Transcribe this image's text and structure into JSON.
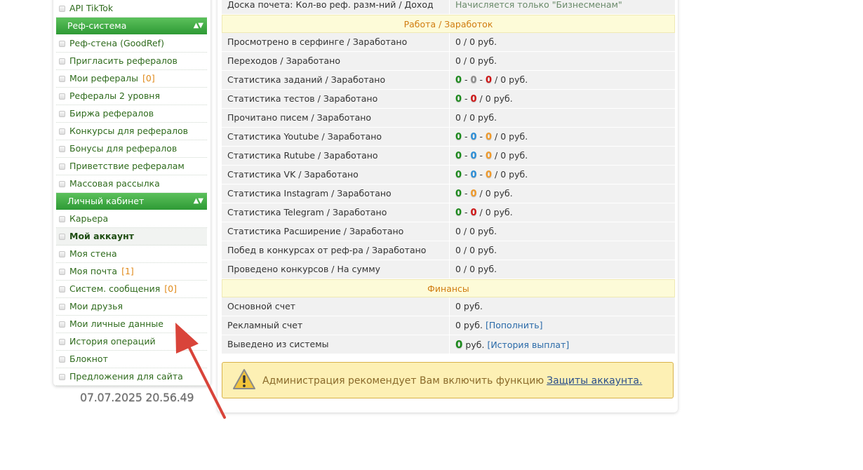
{
  "sidebar": {
    "items": [
      {
        "type": "item",
        "label": "API TikTok"
      },
      {
        "type": "header",
        "label": "Реф-система",
        "toggle": "▲▼"
      },
      {
        "type": "item",
        "label": "Реф-стена (GoodRef)"
      },
      {
        "type": "item",
        "label": "Пригласить рефералов"
      },
      {
        "type": "item",
        "label": "Мои рефералы",
        "count": "[0]"
      },
      {
        "type": "item",
        "label": "Рефералы 2 уровня"
      },
      {
        "type": "item",
        "label": "Биржа рефералов"
      },
      {
        "type": "item",
        "label": "Конкурсы для рефералов"
      },
      {
        "type": "item",
        "label": "Бонусы для рефералов"
      },
      {
        "type": "item",
        "label": "Приветствие рефералам"
      },
      {
        "type": "item",
        "label": "Массовая рассылка"
      },
      {
        "type": "header",
        "label": "Личный кабинет",
        "toggle": "▲▼"
      },
      {
        "type": "item",
        "label": "Карьера"
      },
      {
        "type": "item",
        "label": "Мой аккаунт",
        "active": true
      },
      {
        "type": "item",
        "label": "Моя стена"
      },
      {
        "type": "item",
        "label": "Моя почта",
        "count": "[1]"
      },
      {
        "type": "item",
        "label": "Систем. сообщения",
        "count": "[0]"
      },
      {
        "type": "item",
        "label": "Мои друзья"
      },
      {
        "type": "item",
        "label": "Мои личные данные"
      },
      {
        "type": "item",
        "label": "История операций"
      },
      {
        "type": "item",
        "label": "Блокнот"
      },
      {
        "type": "item",
        "label": "Предложения для сайта"
      }
    ]
  },
  "timestamp": "07.07.2025 20.56.49",
  "stats": {
    "honor_row": {
      "label": "Доска почета: Кол-во реф. разм-ний / Доход",
      "note": "Начисляется только \"Бизнесменам\""
    },
    "work_section": "Работа / Заработок",
    "rows": [
      {
        "label": "Просмотрено в серфинге / Заработано",
        "parts": [],
        "tail": "0 / 0 руб."
      },
      {
        "label": "Переходов / Заработано",
        "parts": [],
        "tail": "0 / 0 руб."
      },
      {
        "label": "Статистика заданий / Заработано",
        "parts": [
          {
            "v": "0",
            "c": "green"
          },
          {
            "v": "0",
            "c": "gray"
          },
          {
            "v": "0",
            "c": "red"
          }
        ],
        "tail": " / 0 руб."
      },
      {
        "label": "Статистика тестов / Заработано",
        "parts": [
          {
            "v": "0",
            "c": "green"
          },
          {
            "v": "0",
            "c": "red"
          }
        ],
        "tail": " / 0 руб."
      },
      {
        "label": "Прочитано писем / Заработано",
        "parts": [],
        "tail": "0 / 0 руб."
      },
      {
        "label": "Статистика Youtube / Заработано",
        "parts": [
          {
            "v": "0",
            "c": "green"
          },
          {
            "v": "0",
            "c": "blue"
          },
          {
            "v": "0",
            "c": "orange"
          }
        ],
        "tail": " / 0 руб."
      },
      {
        "label": "Статистика Rutube / Заработано",
        "parts": [
          {
            "v": "0",
            "c": "green"
          },
          {
            "v": "0",
            "c": "blue"
          },
          {
            "v": "0",
            "c": "orange"
          }
        ],
        "tail": " / 0 руб."
      },
      {
        "label": "Статистика VK / Заработано",
        "parts": [
          {
            "v": "0",
            "c": "green"
          },
          {
            "v": "0",
            "c": "blue"
          },
          {
            "v": "0",
            "c": "orange"
          }
        ],
        "tail": " / 0 руб."
      },
      {
        "label": "Статистика Instagram / Заработано",
        "parts": [
          {
            "v": "0",
            "c": "green"
          },
          {
            "v": "0",
            "c": "orange"
          }
        ],
        "tail": " / 0 руб."
      },
      {
        "label": "Статистика Telegram / Заработано",
        "parts": [
          {
            "v": "0",
            "c": "green"
          },
          {
            "v": "0",
            "c": "red"
          }
        ],
        "tail": " / 0 руб."
      },
      {
        "label": "Статистика Расширение / Заработано",
        "parts": [],
        "tail": "0 / 0 руб."
      },
      {
        "label": "Побед в конкурсах от реф-ра / Заработано",
        "parts": [],
        "tail": "0 / 0 руб."
      },
      {
        "label": "Проведено конкурсов / На сумму",
        "parts": [],
        "tail": "0 / 0 руб."
      }
    ],
    "finance_section": "Финансы",
    "main_account": {
      "label": "Основной счет",
      "value": "0 руб."
    },
    "ad_account": {
      "label": "Рекламный счет",
      "value": "0 руб.",
      "link": "[Пополнить]"
    },
    "withdrawn": {
      "label": "Выведено из системы",
      "num": "0",
      "unit": "руб.",
      "link": "[История выплат]"
    }
  },
  "alert": {
    "text": "Администрация рекомендует Вам включить функцию",
    "link": "Защиты аккаунта."
  },
  "colors": {
    "green": "#1c8a1c",
    "gray": "#8c8c8c",
    "red": "#d01515",
    "blue": "#2a8ed8",
    "orange": "#f09a2a",
    "arrow": "#d9443a"
  }
}
